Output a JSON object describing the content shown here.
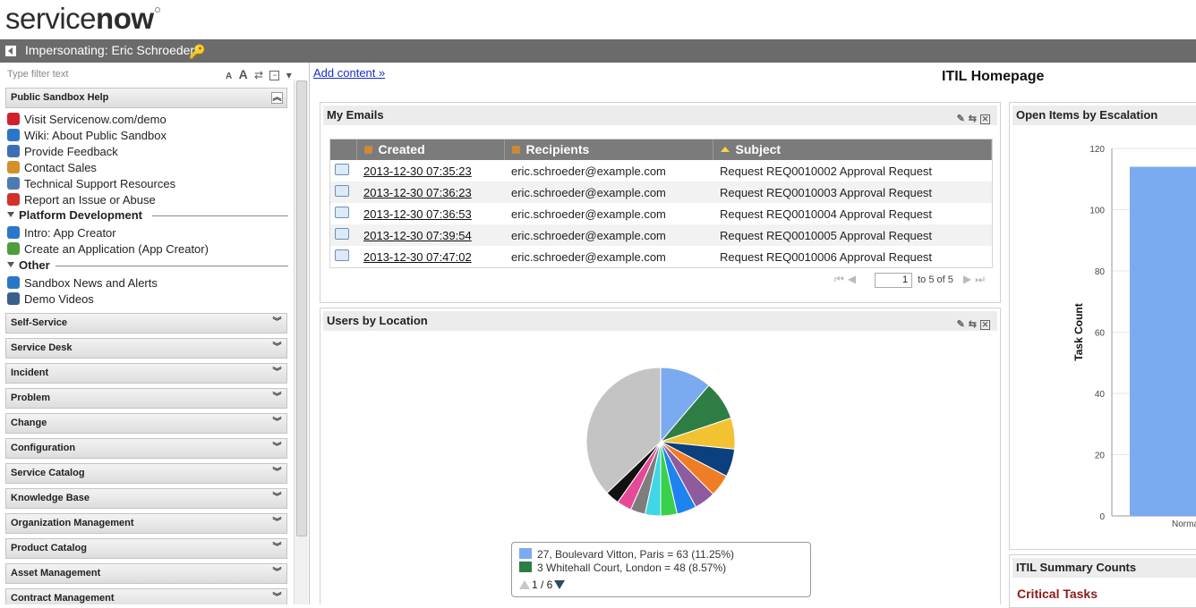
{
  "brand": {
    "name_part1": "service",
    "name_part2": "now"
  },
  "topbar": {
    "impersonating": "Impersonating: Eric Schroeder"
  },
  "leftnav": {
    "filter_placeholder": "Type filter text",
    "tools": {
      "font_small": "A",
      "font_large": "A",
      "refresh": "⇄",
      "collapse": "⊟",
      "menu": "▾"
    },
    "help_section": "Public Sandbox Help",
    "help_items": [
      {
        "label": "Visit Servicenow.com/demo",
        "icon": "demo-icon",
        "color": "#d21f2d"
      },
      {
        "label": "Wiki: About Public Sandbox",
        "icon": "help-icon",
        "color": "#2a77c9"
      },
      {
        "label": "Provide Feedback",
        "icon": "feedback-icon",
        "color": "#3d6fb6"
      },
      {
        "label": "Contact Sales",
        "icon": "contact-icon",
        "color": "#d4902a"
      },
      {
        "label": "Technical Support Resources",
        "icon": "support-icon",
        "color": "#4c7bb4"
      },
      {
        "label": "Report an Issue or Abuse",
        "icon": "alert-icon",
        "color": "#d3302a"
      }
    ],
    "platform_heading": "Platform Development",
    "platform_items": [
      {
        "label": "Intro: App Creator",
        "icon": "info-icon",
        "color": "#2a77c9"
      },
      {
        "label": "Create an Application (App Creator)",
        "icon": "create-app-icon",
        "color": "#4f9d3c"
      }
    ],
    "other_heading": "Other",
    "other_items": [
      {
        "label": "Sandbox News and Alerts",
        "icon": "news-icon",
        "color": "#2a77c9"
      },
      {
        "label": "Demo Videos",
        "icon": "video-icon",
        "color": "#3a5f8a"
      }
    ],
    "sections": [
      "Self-Service",
      "Service Desk",
      "Incident",
      "Problem",
      "Change",
      "Configuration",
      "Service Catalog",
      "Knowledge Base",
      "Organization Management",
      "Product Catalog",
      "Asset Management",
      "Contract Management"
    ]
  },
  "content": {
    "add_content": "Add content »",
    "page_title": "ITIL Homepage"
  },
  "emails": {
    "title": "My Emails",
    "columns": [
      "Created",
      "Recipients",
      "Subject"
    ],
    "rows": [
      {
        "created": "2013-12-30 07:35:23",
        "recipient": "eric.schroeder@example.com",
        "subject": "Request REQ0010002 Approval Request"
      },
      {
        "created": "2013-12-30 07:36:23",
        "recipient": "eric.schroeder@example.com",
        "subject": "Request REQ0010003 Approval Request"
      },
      {
        "created": "2013-12-30 07:36:53",
        "recipient": "eric.schroeder@example.com",
        "subject": "Request REQ0010004 Approval Request"
      },
      {
        "created": "2013-12-30 07:39:54",
        "recipient": "eric.schroeder@example.com",
        "subject": "Request REQ0010005 Approval Request"
      },
      {
        "created": "2013-12-30 07:47:02",
        "recipient": "eric.schroeder@example.com",
        "subject": "Request REQ0010006 Approval Request"
      }
    ],
    "pager": {
      "page": "1",
      "of_text": "to 5 of 5"
    }
  },
  "users_by_location": {
    "title": "Users by Location",
    "legend_rows": [
      {
        "text": "27, Boulevard Vitton, Paris = 63 (11.25%)",
        "color": "#7aaaf0"
      },
      {
        "text": "3 Whitehall Court, London = 48 (8.57%)",
        "color": "#2e7d45"
      }
    ],
    "legend_page": "1 / 6"
  },
  "escalation": {
    "title": "Open Items by Escalation"
  },
  "summary": {
    "title": "ITIL Summary Counts",
    "critical_label": "Critical Tasks"
  },
  "chart_data": [
    {
      "type": "pie",
      "title": "Users by Location",
      "slices": [
        {
          "label": "27, Boulevard Vitton, Paris",
          "value": 63,
          "percent": 11.25,
          "color": "#7aaaf0"
        },
        {
          "label": "3 Whitehall Court, London",
          "value": 48,
          "percent": 8.57,
          "color": "#2e7d45"
        },
        {
          "label": "",
          "value": 38,
          "percent": 6.8,
          "color": "#f2c233"
        },
        {
          "label": "",
          "value": 34,
          "percent": 6.1,
          "color": "#0b3f7d"
        },
        {
          "label": "",
          "value": 27,
          "percent": 4.8,
          "color": "#ef7d25"
        },
        {
          "label": "",
          "value": 26,
          "percent": 4.6,
          "color": "#8e5b9e"
        },
        {
          "label": "",
          "value": 24,
          "percent": 4.3,
          "color": "#1e83f0"
        },
        {
          "label": "",
          "value": 20,
          "percent": 3.6,
          "color": "#3ad14a"
        },
        {
          "label": "",
          "value": 19,
          "percent": 3.4,
          "color": "#3fd6e6"
        },
        {
          "label": "",
          "value": 18,
          "percent": 3.2,
          "color": "#7d7d7d"
        },
        {
          "label": "",
          "value": 18,
          "percent": 3.2,
          "color": "#e64a96"
        },
        {
          "label": "",
          "value": 17,
          "percent": 3.0,
          "color": "#111111"
        },
        {
          "label": "",
          "value": 208,
          "percent": 37.1,
          "color": "#c4c4c4"
        }
      ]
    },
    {
      "type": "bar",
      "title": "Open Items by Escalation",
      "categories": [
        "Norma"
      ],
      "values": [
        114
      ],
      "ylabel": "Task Count",
      "ylim": [
        0,
        120
      ],
      "yticks": [
        0,
        20,
        40,
        60,
        80,
        100,
        120
      ],
      "color": "#7aaaf0"
    }
  ]
}
